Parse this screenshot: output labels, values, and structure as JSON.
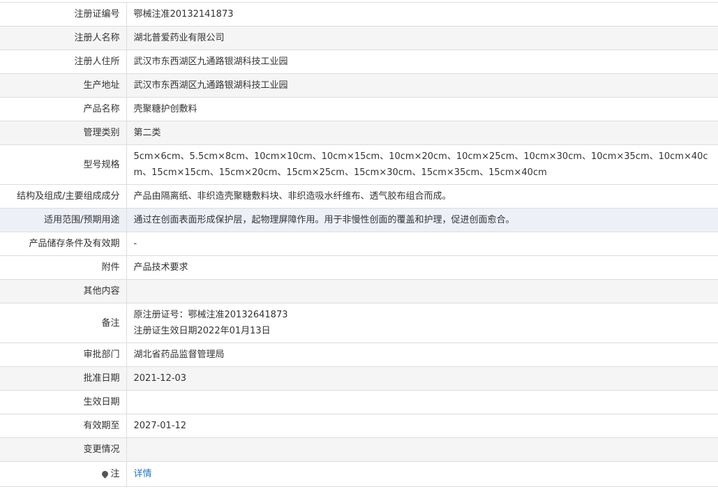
{
  "rows": {
    "reg_no": {
      "label": "注册证编号",
      "value": "鄂械注准20132141873"
    },
    "registrant_name": {
      "label": "注册人名称",
      "value": "湖北普爱药业有限公司"
    },
    "registrant_address": {
      "label": "注册人住所",
      "value": "武汉市东西湖区九通路银湖科技工业园"
    },
    "production_address": {
      "label": "生产地址",
      "value": "武汉市东西湖区九通路银湖科技工业园"
    },
    "product_name": {
      "label": "产品名称",
      "value": "壳聚糖护创敷料"
    },
    "management_class": {
      "label": "管理类别",
      "value": "第二类"
    },
    "model_spec": {
      "label": "型号规格",
      "value": "5cm×6cm、5.5cm×8cm、10cm×10cm、10cm×15cm、10cm×20cm、10cm×25cm、10cm×30cm、10cm×35cm、10cm×40cm、15cm×15cm、15cm×20cm、15cm×25cm、15cm×30cm、15cm×35cm、15cm×40cm"
    },
    "composition": {
      "label": "结构及组成/主要组成成分",
      "value": "产品由隔离纸、非织造壳聚糖敷料块、非织造吸水纤维布、透气胶布组合而成。"
    },
    "intended_use": {
      "label": "适用范围/预期用途",
      "value": "通过在创面表面形成保护层，起物理屏障作用。用于非慢性创面的覆盖和护理，促进创面愈合。"
    },
    "storage": {
      "label": "产品储存条件及有效期",
      "value": "-"
    },
    "attachment": {
      "label": "附件",
      "value": "产品技术要求"
    },
    "other": {
      "label": "其他内容",
      "value": ""
    },
    "remarks": {
      "label": "备注",
      "line1": "原注册证号：鄂械注准20132641873",
      "line2": "注册证生效日期2022年01月13日"
    },
    "approval_dept": {
      "label": "审批部门",
      "value": "湖北省药品监督管理局"
    },
    "approval_date": {
      "label": "批准日期",
      "value": "2021-12-03"
    },
    "effective_date": {
      "label": "生效日期",
      "value": ""
    },
    "valid_until": {
      "label": "有效期至",
      "value": "2027-01-12"
    },
    "changes": {
      "label": "变更情况",
      "value": ""
    },
    "note": {
      "label": "注",
      "icon": "map-pin-icon",
      "link_text": "详情"
    }
  },
  "colors": {
    "border": "#dddddd",
    "even_row_bg": "#f5f5f5",
    "highlight_row_bg": "#eef0f8",
    "link": "#2a74c7",
    "text": "#333333"
  }
}
